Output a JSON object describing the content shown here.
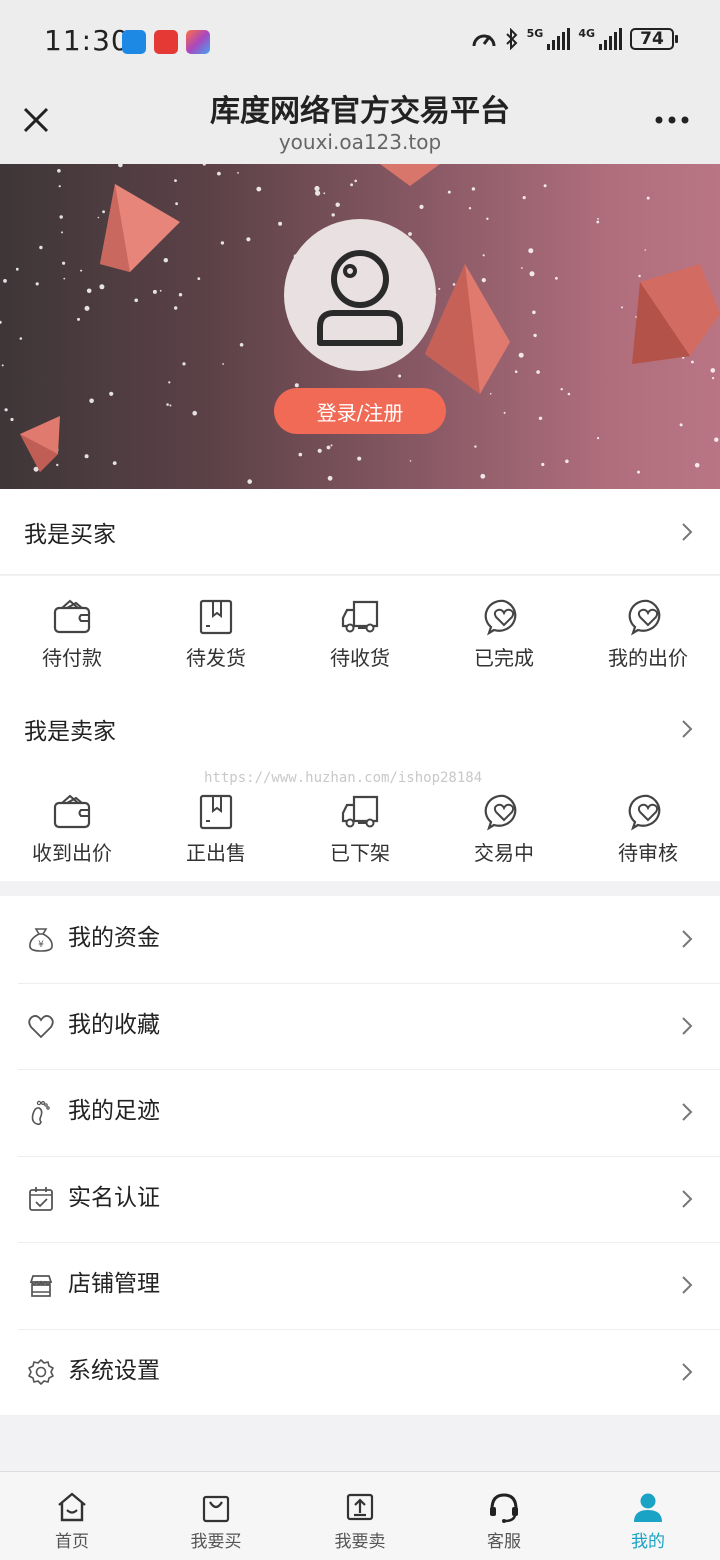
{
  "status_bar": {
    "time": "11:30",
    "network_5g": "5G",
    "network_4g": "4G",
    "battery": "74"
  },
  "title_bar": {
    "title": "库度网络官方交易平台",
    "url": "youxi.oa123.top"
  },
  "hero": {
    "login_label": "登录/注册"
  },
  "buyer": {
    "title": "我是买家",
    "items": [
      {
        "label": "待付款",
        "icon": "wallet-icon"
      },
      {
        "label": "待发货",
        "icon": "bookmark-box-icon"
      },
      {
        "label": "待收货",
        "icon": "truck-icon"
      },
      {
        "label": "已完成",
        "icon": "heart-bubble-icon"
      },
      {
        "label": "我的出价",
        "icon": "heart-bubble-icon"
      }
    ]
  },
  "seller": {
    "title": "我是卖家",
    "items": [
      {
        "label": "收到出价",
        "icon": "wallet-icon"
      },
      {
        "label": "正出售",
        "icon": "bookmark-box-icon"
      },
      {
        "label": "已下架",
        "icon": "truck-icon"
      },
      {
        "label": "交易中",
        "icon": "heart-bubble-icon"
      },
      {
        "label": "待审核",
        "icon": "heart-bubble-icon"
      }
    ]
  },
  "watermark": "https://www.huzhan.com/ishop28184",
  "menu": [
    {
      "label": "我的资金",
      "icon": "money-bag-icon"
    },
    {
      "label": "我的收藏",
      "icon": "heart-icon"
    },
    {
      "label": "我的足迹",
      "icon": "footprint-icon"
    },
    {
      "label": "实名认证",
      "icon": "calendar-check-icon"
    },
    {
      "label": "店铺管理",
      "icon": "store-icon"
    },
    {
      "label": "系统设置",
      "icon": "gear-icon"
    }
  ],
  "tabbar": [
    {
      "label": "首页",
      "icon": "home-icon"
    },
    {
      "label": "我要买",
      "icon": "shopping-bag-icon"
    },
    {
      "label": "我要卖",
      "icon": "upload-icon"
    },
    {
      "label": "客服",
      "icon": "headset-icon"
    },
    {
      "label": "我的",
      "icon": "user-icon",
      "active": true
    }
  ],
  "colors": {
    "accent": "#1aa3c4",
    "login_button": "#f06a56"
  }
}
